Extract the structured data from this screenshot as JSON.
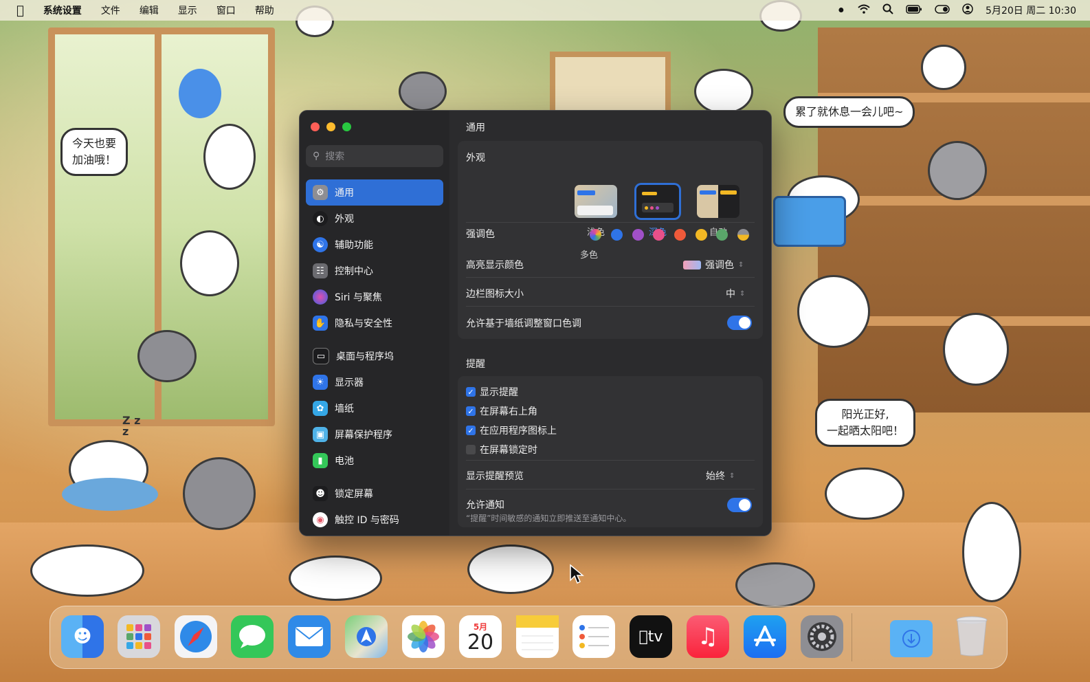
{
  "menubar": {
    "app_name": "系统设置",
    "menus": [
      "文件",
      "编辑",
      "显示",
      "窗口",
      "帮助"
    ],
    "clock": "5月20日 周二 10:30"
  },
  "wallpaper": {
    "bubbles": [
      "今天也要\n加油哦！",
      "累了就休息一会儿吧~",
      "阳光正好,\n一起晒太阳吧！"
    ],
    "sleep_text": "Z z\nz"
  },
  "settings": {
    "search_placeholder": "搜索",
    "sidebar": [
      {
        "label": "通用",
        "icon": "gear-icon",
        "color": "#8e8e93",
        "active": true
      },
      {
        "label": "外观",
        "icon": "appearance-icon",
        "color": "#1c1c1e"
      },
      {
        "label": "辅助功能",
        "icon": "accessibility-icon",
        "color": "#2f74e8"
      },
      {
        "label": "控制中心",
        "icon": "control-center-icon",
        "color": "#6b6b70"
      },
      {
        "label": "Siri 与聚焦",
        "icon": "siri-icon",
        "color": "#5b3fd1"
      },
      {
        "label": "隐私与安全性",
        "icon": "hand-icon",
        "color": "#2f74e8"
      },
      {
        "label": "桌面与程序坞",
        "icon": "dock-icon",
        "color": "#1c1c1e"
      },
      {
        "label": "显示器",
        "icon": "brightness-icon",
        "color": "#2f74e8"
      },
      {
        "label": "墙纸",
        "icon": "flower-icon",
        "color": "#35a7e6"
      },
      {
        "label": "屏幕保护程序",
        "icon": "screensaver-icon",
        "color": "#4fb2e8"
      },
      {
        "label": "电池",
        "icon": "battery-icon",
        "color": "#34c759"
      },
      {
        "label": "锁定屏幕",
        "icon": "lock-screen-icon",
        "color": "#1c1c1e"
      },
      {
        "label": "触控 ID 与密码",
        "icon": "fingerprint-icon",
        "color": "#e45b6a"
      }
    ],
    "title": "通用",
    "appearance": {
      "label": "外观",
      "options": [
        "浅色",
        "深色",
        "自动"
      ],
      "selected": "深色"
    },
    "accent": {
      "label": "强调色",
      "caption": "多色",
      "colors": [
        "#b07de0",
        "#2f74e8",
        "#a050c8",
        "#e8508a",
        "#ef5a3a",
        "#f2b824",
        "#5aa66a",
        "#8e8e93"
      ]
    },
    "highlight": {
      "label": "高亮显示颜色",
      "value": "强调色"
    },
    "sidebar_icon_size": {
      "label": "边栏图标大小",
      "value": "中"
    },
    "wallpaper_tint": {
      "label": "允许基于墙纸调整窗口色调",
      "on": true
    },
    "notifications": {
      "section": "提醒",
      "checks": [
        {
          "label": "显示提醒",
          "checked": true
        },
        {
          "label": "在屏幕右上角",
          "checked": true
        },
        {
          "label": "在应用程序图标上",
          "checked": true
        },
        {
          "label": "在屏幕锁定时",
          "checked": false
        }
      ],
      "preview": {
        "label": "显示提醒预览",
        "value": "始终"
      },
      "allow": {
        "label": "允许通知",
        "desc": "“提醒”时间敏感的通知立即推送至通知中心。",
        "on": true
      }
    }
  },
  "dock": {
    "calendar_month": "5月",
    "calendar_day": "20",
    "tv_label": "tv",
    "apps": [
      "finder-icon",
      "launchpad-icon",
      "safari-icon",
      "messages-icon",
      "mail-icon",
      "maps-icon",
      "photos-icon",
      "calendar-icon",
      "notes-icon",
      "reminders-icon",
      "tv-icon",
      "music-icon",
      "app-store-icon",
      "system-settings-icon",
      "downloads-icon",
      "trash-icon"
    ]
  }
}
